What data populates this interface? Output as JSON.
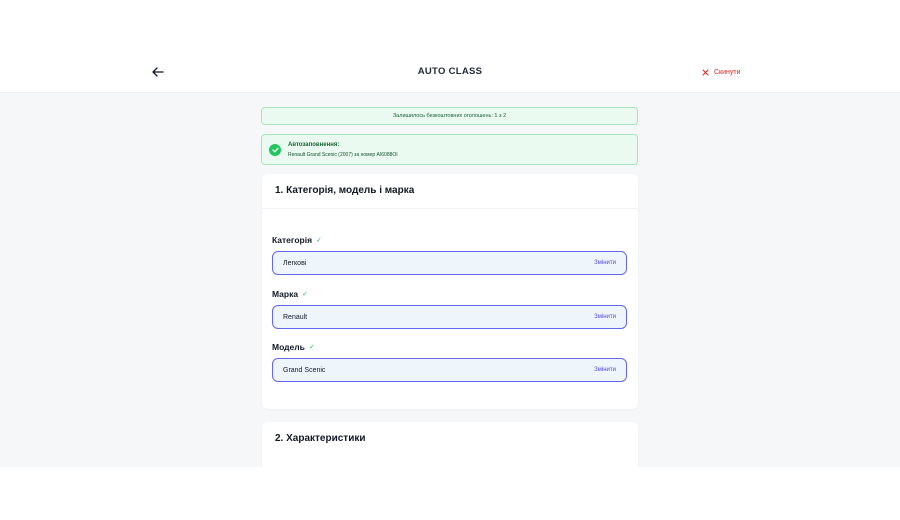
{
  "header": {
    "title": "AUTO CLASS",
    "back_icon": "arrow-left-icon",
    "reset_label": "Скинути",
    "reset_color": "#dc2626"
  },
  "info_banner": {
    "text": "Залишилось безкоштовних оголошень: 1 з 2"
  },
  "autofill": {
    "title": "Автозаповнення:",
    "text": "Renault Grand Scenic (2007) за номер AI6088OI",
    "icon": "check-circle-icon"
  },
  "section1": {
    "title": "1. Категорія, модель і марка",
    "fields": [
      {
        "label": "Категорія",
        "check": "✓",
        "value": "Легкові",
        "action": "Змінити"
      },
      {
        "label": "Марка",
        "check": "✓",
        "value": "Renault",
        "action": "Змінити"
      },
      {
        "label": "Модель",
        "check": "✓",
        "value": "Grand Scenic",
        "action": "Змінити"
      }
    ]
  },
  "section2": {
    "title": "2. Характеристики"
  },
  "colors": {
    "accent": "#4f46e5",
    "success": "#22c55e",
    "field_bg": "#eff6fb",
    "page_bg": "#f6f7f9"
  }
}
